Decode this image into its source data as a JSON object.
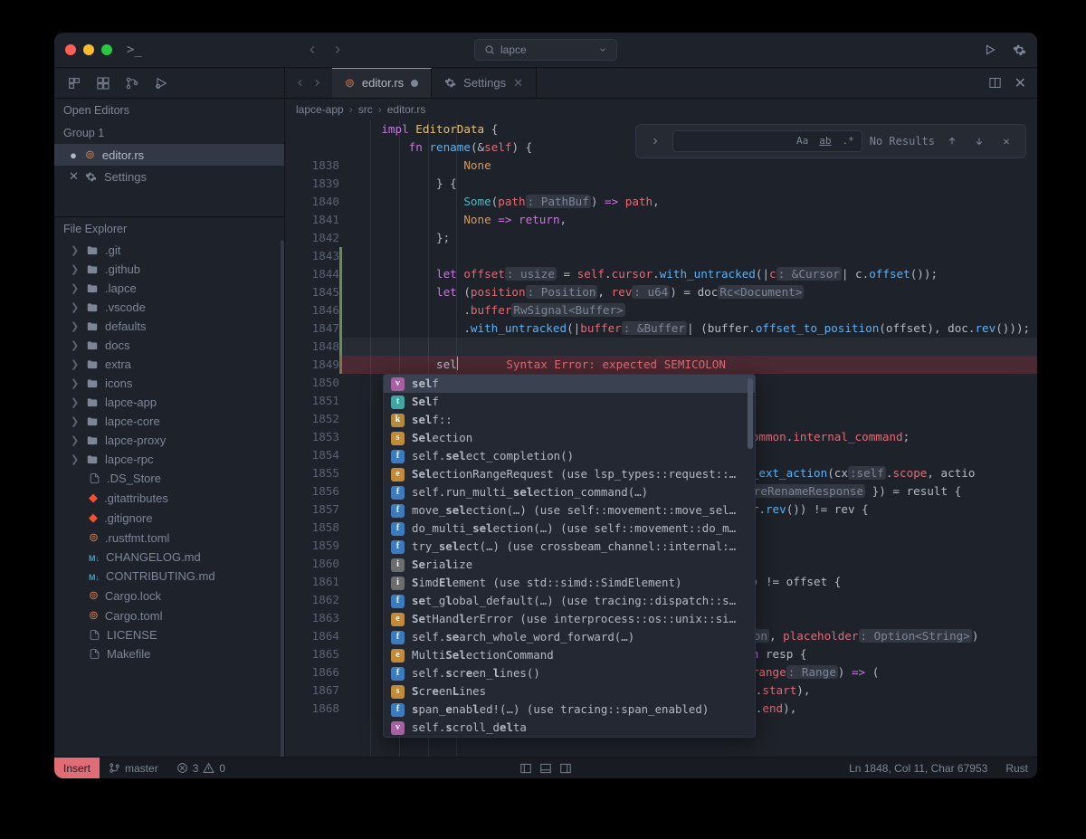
{
  "title_search": "lapce",
  "tabs": [
    {
      "label": "editor.rs",
      "icon": "rust",
      "modified": true,
      "active": true
    },
    {
      "label": "Settings",
      "icon": "gear",
      "closeable": true
    }
  ],
  "breadcrumb": [
    "lapce-app",
    "src",
    "editor.rs"
  ],
  "open_editors": {
    "title": "Open Editors",
    "group_label": "Group 1",
    "items": [
      {
        "label": "editor.rs",
        "icon": "rust",
        "modified": true,
        "selected": true
      },
      {
        "label": "Settings",
        "icon": "gear",
        "closeable": true
      }
    ]
  },
  "file_explorer": {
    "title": "File Explorer",
    "items": [
      {
        "label": ".git",
        "kind": "folder",
        "expandable": true
      },
      {
        "label": ".github",
        "kind": "folder",
        "expandable": true
      },
      {
        "label": ".lapce",
        "kind": "folder",
        "expandable": true
      },
      {
        "label": ".vscode",
        "kind": "folder",
        "expandable": true
      },
      {
        "label": "defaults",
        "kind": "folder",
        "expandable": true
      },
      {
        "label": "docs",
        "kind": "folder",
        "expandable": true
      },
      {
        "label": "extra",
        "kind": "folder",
        "expandable": true
      },
      {
        "label": "icons",
        "kind": "folder",
        "expandable": true
      },
      {
        "label": "lapce-app",
        "kind": "folder",
        "expandable": true
      },
      {
        "label": "lapce-core",
        "kind": "folder",
        "expandable": true
      },
      {
        "label": "lapce-proxy",
        "kind": "folder",
        "expandable": true
      },
      {
        "label": "lapce-rpc",
        "kind": "folder",
        "expandable": true
      },
      {
        "label": ".DS_Store",
        "kind": "file"
      },
      {
        "label": ".gitattributes",
        "kind": "git"
      },
      {
        "label": ".gitignore",
        "kind": "git"
      },
      {
        "label": ".rustfmt.toml",
        "kind": "rust"
      },
      {
        "label": "CHANGELOG.md",
        "kind": "md"
      },
      {
        "label": "CONTRIBUTING.md",
        "kind": "md"
      },
      {
        "label": "Cargo.lock",
        "kind": "rust"
      },
      {
        "label": "Cargo.toml",
        "kind": "rust"
      },
      {
        "label": "LICENSE",
        "kind": "file"
      },
      {
        "label": "Makefile",
        "kind": "file"
      }
    ]
  },
  "editor": {
    "first_line": 1838,
    "sticky_header": [
      "impl EditorData {",
      "    fn rename(&self) {"
    ],
    "active_line_index": 11,
    "error_text": "Syntax Error: expected SEMICOLON",
    "lines_html": [
      "                <span class='tok-none'>None</span>",
      "            } {",
      "                <span class='tok-some'>Some</span>(<span class='tok-param'>path</span><span class='tok-hint'>: PathBuf</span>) <span class='tok-kw'>=&gt;</span> <span class='tok-var'>path</span>,",
      "                <span class='tok-none'>None</span> <span class='tok-kw'>=&gt;</span> <span class='tok-kw'>return</span>,",
      "            };",
      "",
      "            <span class='tok-kw'>let</span> <span class='tok-var'>offset</span><span class='tok-hint'>: usize</span> = <span class='tok-self'>self</span>.<span class='tok-field'>cursor</span>.<span class='tok-fn'>with_untracked</span>(|<span class='tok-param'>c</span><span class='tok-hint'>: &amp;Cursor</span>| c.<span class='tok-fn'>offset</span>());",
      "            <span class='tok-kw'>let</span> (<span class='tok-var'>position</span><span class='tok-hint'>: Position</span>, <span class='tok-var'>rev</span><span class='tok-hint'>: u64</span>) = doc<span class='tok-hint'>Rc&lt;Document&gt;</span>",
      "                .<span class='tok-field'>buffer</span><span class='tok-hint'>RwSignal&lt;Buffer&gt;</span>",
      "                .<span class='tok-fn'>with_untracked</span>(|<span class='tok-param'>buffer</span><span class='tok-hint'>: &amp;Buffer</span>| (buffer.<span class='tok-fn'>offset_to_position</span>(offset), doc.<span class='tok-fn'>rev</span>()));",
      "",
      "            sel<span class='cursor-caret'></span>       <span class='tok-err'>Syntax Error: expected SEMICOLON</span>",
      "",
      "",
      "",
      "                                                  = <span class='tok-self'>self</span>.<span class='tok-field'>common</span>.<span class='tok-field'>internal_command</span>;",
      "",
      "                                                  = <span class='tok-fn'>create_ext_action</span>(cx<span class='tok-hint'>:self</span>.<span class='tok-field'>scope</span>, actio",
      "                                                  <span class='tok-param'>p</span><span class='tok-hint'>: PrepareRenameResponse</span> }) = result {",
      "                                                  <span class='tok-param'>r</span>| buffer.<span class='tok-fn'>rev</span>()) != rev {",
      "",
      "",
      "",
      "                                                  <span class='tok-fn'>offset</span>()) != offset {",
      "",
      "",
      "                                                  <span class='tok-hint'>: Position</span>, <span class='tok-var'>placeholder</span><span class='tok-hint'>: Option&lt;String&gt;</span>)",
      "                                                  <span class='tok-param'>er</span>| <span class='tok-kw'>match</span> resp {",
      "                                                  ::<span class='tok-ty'>Range</span>(<span class='tok-var'>range</span><span class='tok-hint'>: Range</span>) <span class='tok-kw'>=&gt;</span> (",
      "                                                  <span class='tok-hint'>s:</span>&amp;range.<span class='tok-field'>start</span>),",
      "                                                  <span class='tok-hint'>s:</span>&amp;range.<span class='tok-field'>end</span>),"
    ]
  },
  "completion": {
    "selected": 0,
    "items": [
      {
        "k": "v",
        "html": "<span class='b'>sel</span>f"
      },
      {
        "k": "t",
        "html": "<span class='b'>Sel</span>f"
      },
      {
        "k": "k",
        "html": "<span class='b'>sel</span>f::"
      },
      {
        "k": "s",
        "html": "<span class='b'>Sel</span>ection"
      },
      {
        "k": "f",
        "html": "self.<span class='b'>sel</span>ect_completion()"
      },
      {
        "k": "e",
        "html": "<span class='b'>Sel</span>ectionRangeRequest (use lsp_types::request::…"
      },
      {
        "k": "f",
        "html": "self.run_multi_<span class='b'>sel</span>ection_command(…)"
      },
      {
        "k": "f",
        "html": "move_<span class='b'>sel</span>ection(…) (use self::movement::move_sel…"
      },
      {
        "k": "f",
        "html": "do_multi_<span class='b'>sel</span>ection(…) (use self::movement::do_m…"
      },
      {
        "k": "f",
        "html": "try_<span class='b'>sel</span>ect(…) (use crossbeam_channel::internal:…"
      },
      {
        "k": "i",
        "html": "<span class='b'>Se</span>ria<span class='b'>l</span>ize"
      },
      {
        "k": "i",
        "html": "<span class='b'>S</span>imd<span class='b'>El</span>ement (use std::simd::SimdElement)"
      },
      {
        "k": "f",
        "html": "<span class='b'>se</span>t_g<span class='b'>l</span>obal_default(…) (use tracing::dispatch::s…"
      },
      {
        "k": "e",
        "html": "<span class='b'>Se</span>tHand<span class='b'>l</span>erError (use interprocess::os::unix::si…"
      },
      {
        "k": "f",
        "html": "self.<span class='b'>se</span>arch_whole_word_forward(…)"
      },
      {
        "k": "e",
        "html": "Multi<span class='b'>Sel</span>ectionCommand"
      },
      {
        "k": "f",
        "html": "self.<span class='b'>s</span>cr<span class='b'>e</span>en_<span class='b'>l</span>ines()"
      },
      {
        "k": "s",
        "html": "<span class='b'>S</span>cr<span class='b'>e</span>en<span class='b'>L</span>ines"
      },
      {
        "k": "f",
        "html": "<span class='b'>s</span>pan_<span class='b'>e</span>nab<span class='b'>l</span>ed!(…) (use tracing::span_enabled)"
      },
      {
        "k": "v",
        "html": "self.<span class='b'>s</span>croll_d<span class='b'>el</span>ta"
      }
    ]
  },
  "find": {
    "no_results": "No Results",
    "opts": [
      "Aa",
      "ab",
      ".*"
    ]
  },
  "status": {
    "mode": "Insert",
    "branch": "master",
    "errors": "3",
    "warnings": "0",
    "position": "Ln 1848, Col 11, Char 67953",
    "lang": "Rust"
  }
}
